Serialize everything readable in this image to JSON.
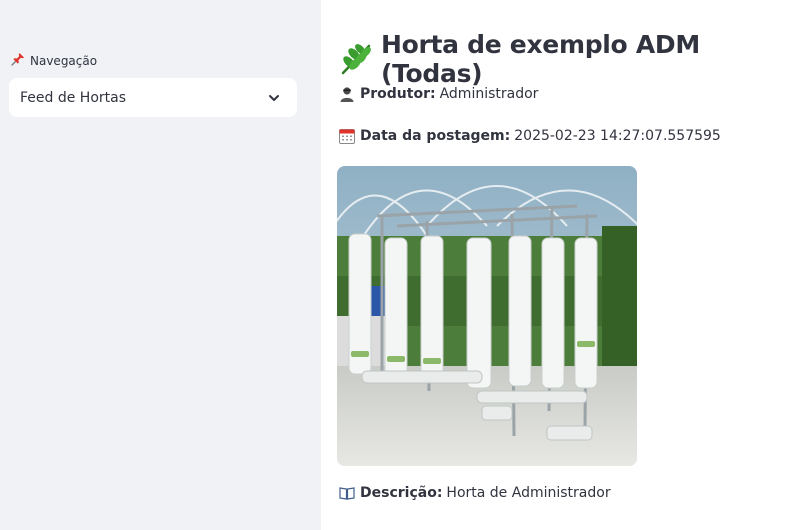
{
  "sidebar": {
    "nav_label": "Navegação",
    "nav_icon": "pin-icon",
    "select": {
      "value": "Feed de Hortas"
    }
  },
  "post": {
    "title_icon": "leaf-icon",
    "title": "Horta de exemplo ADM (Todas)",
    "producer_label": "Produtor:",
    "producer_value": "Administrador",
    "date_label": "Data da postagem:",
    "date_value": "2025-02-23 14:27:07.557595",
    "description_label": "Descrição:",
    "description_value": "Horta de Administrador"
  },
  "colors": {
    "sidebar_bg": "#f0f2f6",
    "text": "#31333f",
    "leaf": "#3a9b2f"
  }
}
